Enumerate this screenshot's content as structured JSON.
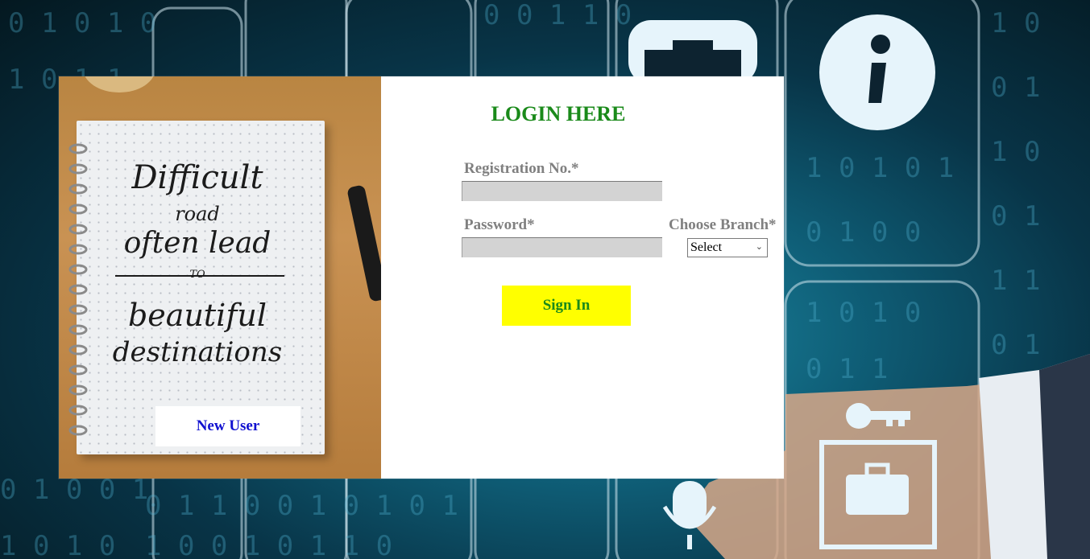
{
  "page": {
    "background_color": "#0b4a63",
    "accent_color": "#1a8a1a"
  },
  "left_panel": {
    "quote_lines": [
      "Difficult",
      "road",
      "often lead",
      "TO",
      "beautiful",
      "destinations"
    ],
    "new_user_label": "New User"
  },
  "login_form": {
    "title": "LOGIN HERE",
    "registration_label": "Registration No.*",
    "registration_value": "",
    "password_label": "Password*",
    "password_value": "",
    "branch_label": "Choose Branch*",
    "branch_selected": "Select",
    "signin_label": "Sign In",
    "signin_color": "#ffff00"
  },
  "background_icons": [
    "info-icon",
    "camera-icon",
    "key-icon",
    "suitcase-icon",
    "microphone-icon"
  ]
}
